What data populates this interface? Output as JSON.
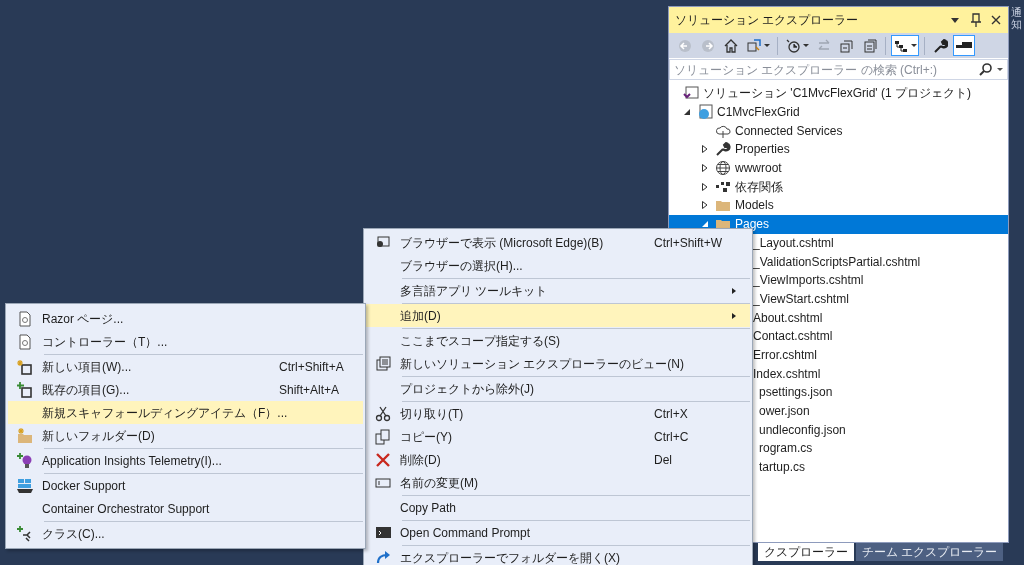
{
  "side_label": "通知",
  "solution_explorer": {
    "title": "ソリューション エクスプローラー",
    "toolbar_buttons": [
      {
        "on": false
      },
      {
        "on": false
      },
      {
        "on": false
      },
      {
        "on": false
      },
      {
        "on": false
      },
      {
        "on": false
      },
      {
        "on": false
      },
      {
        "on": false
      },
      {
        "on": true
      },
      {
        "on": false
      },
      {
        "on": true
      }
    ],
    "search": {
      "placeholder": "ソリューション エクスプローラー の検索 (Ctrl+:)"
    },
    "tree": [
      {
        "label": "ソリューション 'C1MvcFlexGrid' (1 プロジェクト)",
        "kind": "solution",
        "selected": false,
        "children": [
          {
            "label": "C1MvcFlexGrid",
            "kind": "project",
            "expanded": true,
            "selected": false,
            "children": [
              {
                "label": "Connected Services",
                "kind": "connected",
                "selected": false
              },
              {
                "label": "Properties",
                "kind": "properties",
                "expanded": false,
                "selected": false
              },
              {
                "label": "wwwroot",
                "kind": "web",
                "expanded": false,
                "selected": false
              },
              {
                "label": "依存関係",
                "kind": "dependencies",
                "expanded": false,
                "selected": false
              },
              {
                "label": "Models",
                "kind": "folder",
                "expanded": false,
                "selected": false
              },
              {
                "label": "Pages",
                "kind": "folder",
                "expanded": true,
                "selected": true,
                "children": [
                  {
                    "label": "_Layout.cshtml",
                    "kind": "file",
                    "selected": false
                  },
                  {
                    "label": "_ValidationScriptsPartial.cshtml",
                    "kind": "file",
                    "selected": false
                  },
                  {
                    "label": "_ViewImports.cshtml",
                    "kind": "file",
                    "selected": false
                  },
                  {
                    "label": "_ViewStart.cshtml",
                    "kind": "file",
                    "selected": false
                  },
                  {
                    "label": "About.cshtml",
                    "kind": "file",
                    "selected": false
                  },
                  {
                    "label": "Contact.cshtml",
                    "kind": "file",
                    "selected": false
                  },
                  {
                    "label": "Error.cshtml",
                    "kind": "file",
                    "selected": false
                  },
                  {
                    "label": "Index.cshtml",
                    "kind": "file",
                    "selected": false
                  }
                ]
              },
              {
                "label": "psettings.json",
                "kind": "partial",
                "selected": false
              },
              {
                "label": "ower.json",
                "kind": "partial",
                "selected": false
              },
              {
                "label": "undleconfig.json",
                "kind": "partial",
                "selected": false
              },
              {
                "label": "rogram.cs",
                "kind": "partial",
                "selected": false
              },
              {
                "label": "tartup.cs",
                "kind": "partial",
                "selected": false
              }
            ]
          }
        ]
      }
    ],
    "tabs": [
      {
        "label": "クスプローラー",
        "selected": true
      },
      {
        "label": "チーム エクスプローラー",
        "selected": false
      }
    ]
  },
  "context_menu": {
    "items": [
      {
        "kind": "item",
        "label": "ブラウザーで表示 (Microsoft Edge)(B)",
        "shortcut": "Ctrl+Shift+W",
        "submenu": false,
        "selected": false
      },
      {
        "kind": "item",
        "label": "ブラウザーの選択(H)...",
        "submenu": false,
        "selected": false
      },
      {
        "kind": "separator"
      },
      {
        "kind": "item",
        "label": "多言語アプリ ツールキット",
        "submenu": true,
        "selected": false
      },
      {
        "kind": "separator"
      },
      {
        "kind": "item",
        "label": "追加(D)",
        "submenu": true,
        "selected": true
      },
      {
        "kind": "separator"
      },
      {
        "kind": "item",
        "label": "ここまでスコープ指定する(S)",
        "submenu": false,
        "selected": false
      },
      {
        "kind": "item",
        "label": "新しいソリューション エクスプローラーのビュー(N)",
        "submenu": false,
        "selected": false
      },
      {
        "kind": "separator"
      },
      {
        "kind": "item",
        "label": "プロジェクトから除外(J)",
        "submenu": false,
        "selected": false
      },
      {
        "kind": "separator"
      },
      {
        "kind": "item",
        "label": "切り取り(T)",
        "shortcut": "Ctrl+X",
        "submenu": false,
        "selected": false
      },
      {
        "kind": "item",
        "label": "コピー(Y)",
        "shortcut": "Ctrl+C",
        "submenu": false,
        "selected": false
      },
      {
        "kind": "item",
        "label": "削除(D)",
        "shortcut": "Del",
        "submenu": false,
        "selected": false
      },
      {
        "kind": "item",
        "label": "名前の変更(M)",
        "submenu": false,
        "selected": false
      },
      {
        "kind": "separator"
      },
      {
        "kind": "item",
        "label": "Copy Path",
        "submenu": false,
        "selected": false
      },
      {
        "kind": "separator"
      },
      {
        "kind": "item",
        "label": "Open Command Prompt",
        "submenu": false,
        "selected": false
      },
      {
        "kind": "separator"
      },
      {
        "kind": "item",
        "label": "エクスプローラーでフォルダーを開く(X)",
        "submenu": false,
        "selected": false
      }
    ]
  },
  "add_submenu": {
    "items": [
      {
        "kind": "item",
        "label": "Razor ページ...",
        "selected": false
      },
      {
        "kind": "item",
        "label": "コントローラー（T）...",
        "selected": false
      },
      {
        "kind": "separator"
      },
      {
        "kind": "item",
        "label": "新しい項目(W)...",
        "shortcut": "Ctrl+Shift+A",
        "selected": false
      },
      {
        "kind": "item",
        "label": "既存の項目(G)...",
        "shortcut": "Shift+Alt+A",
        "selected": false
      },
      {
        "kind": "item",
        "label": "新規スキャフォールディングアイテム（F）...",
        "selected": true
      },
      {
        "kind": "item",
        "label": "新しいフォルダー(D)",
        "selected": false
      },
      {
        "kind": "separator"
      },
      {
        "kind": "item",
        "label": "Application Insights Telemetry(I)...",
        "selected": false
      },
      {
        "kind": "separator"
      },
      {
        "kind": "item",
        "label": "Docker Support",
        "selected": false
      },
      {
        "kind": "item",
        "label": "Container Orchestrator Support",
        "selected": false
      },
      {
        "kind": "separator"
      },
      {
        "kind": "item",
        "label": "クラス(C)...",
        "selected": false
      }
    ]
  }
}
